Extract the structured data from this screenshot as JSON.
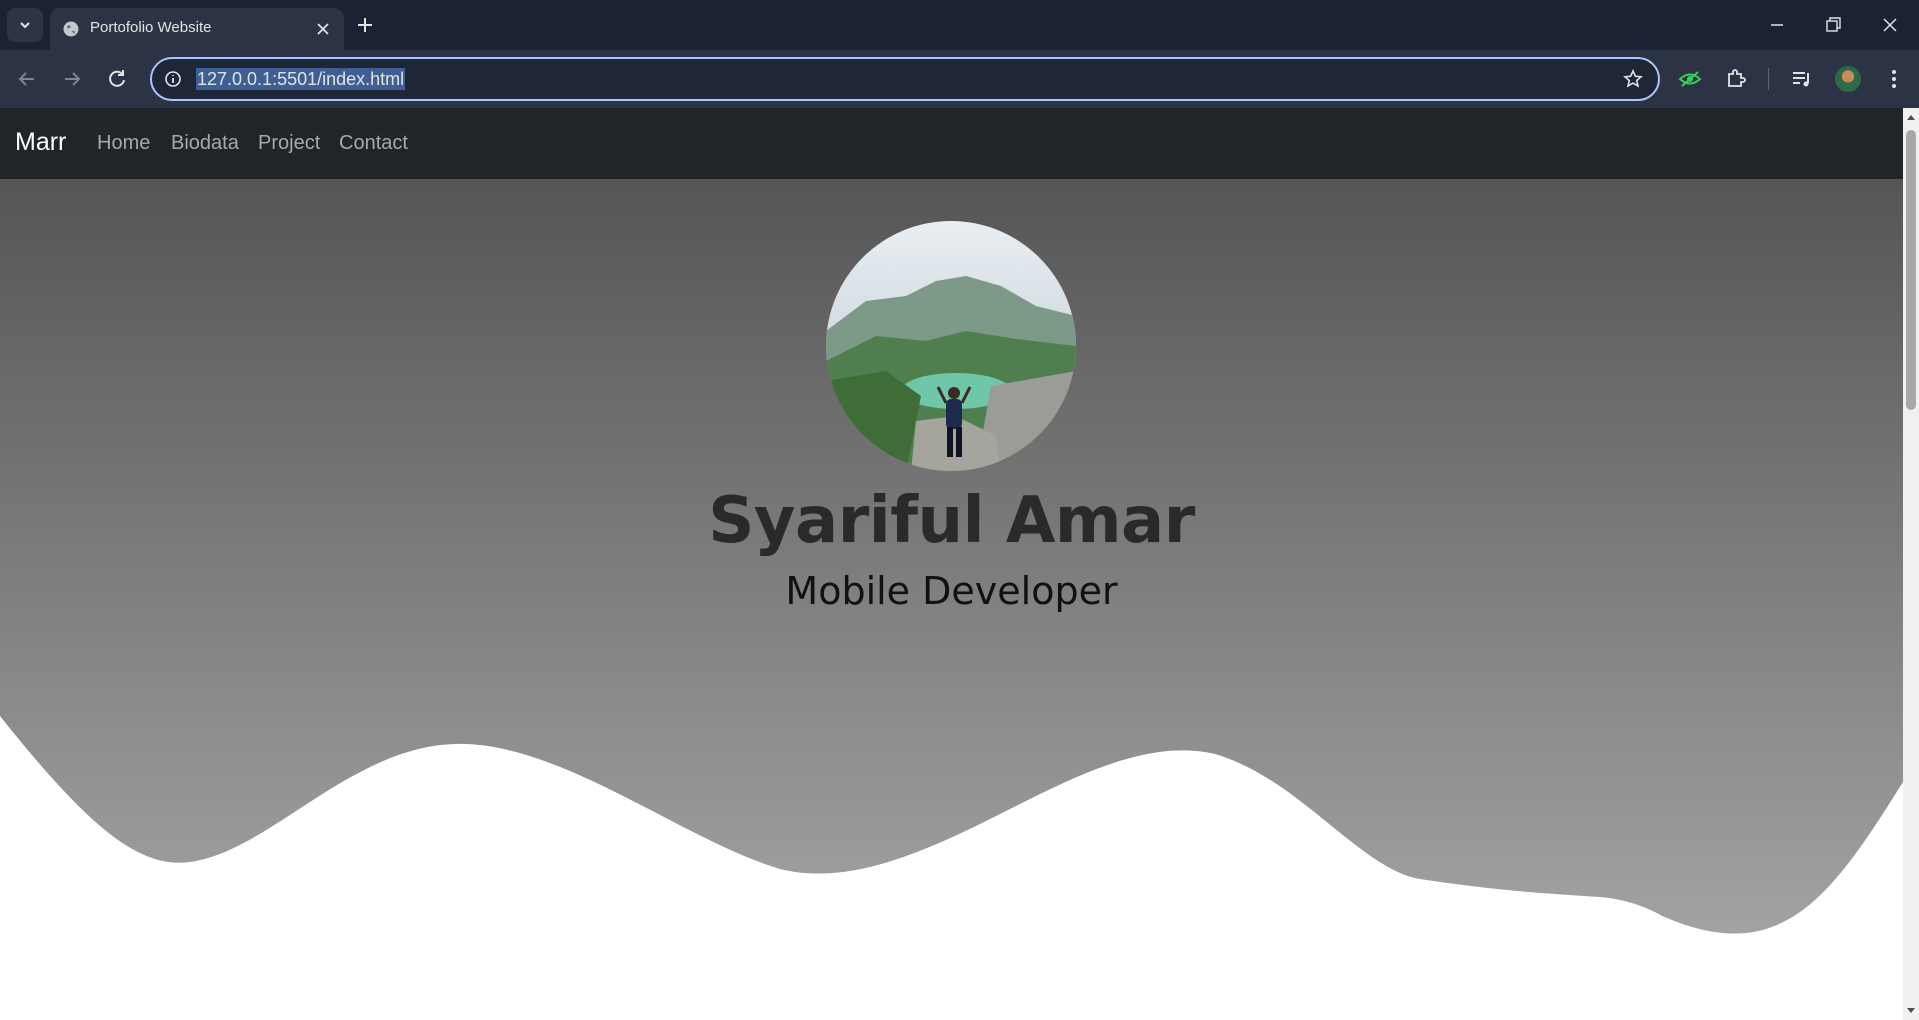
{
  "browser": {
    "tab": {
      "title": "Portofolio Website"
    },
    "address_bar": {
      "url": "127.0.0.1:5501/index.html"
    }
  },
  "navbar": {
    "brand": "Marr",
    "links": [
      "Home",
      "Biodata",
      "Project",
      "Contact"
    ]
  },
  "hero": {
    "name": "Syariful Amar",
    "role": "Mobile Developer"
  },
  "colors": {
    "navbar_bg": "#212529",
    "hero_gradient_top": "#555555",
    "hero_gradient_bottom": "#a6a6a6",
    "chrome_bg": "#1b2233"
  }
}
